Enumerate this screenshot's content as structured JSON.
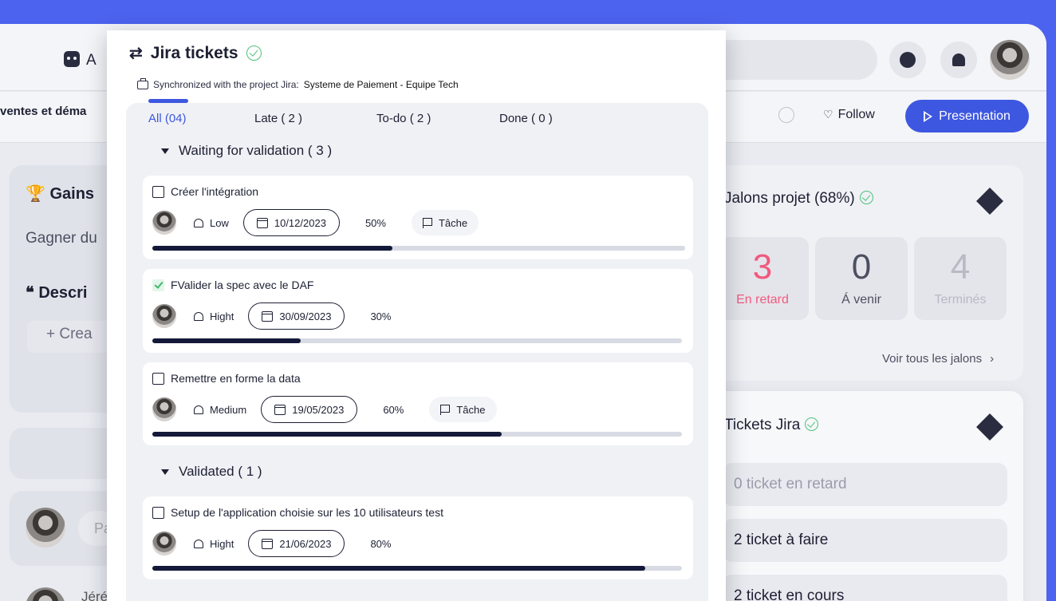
{
  "background": {
    "bot_label": "A",
    "breadcrumb": "ventes et déma",
    "follow_label": "Follow",
    "presentation_label": "Presentation",
    "left": {
      "gains": "Gains",
      "gagner": "Gagner du",
      "description": "Descri",
      "create": "Crea",
      "pill": "Pa",
      "name": "Jéré"
    },
    "jalons": {
      "title": "Jalons projet (68%)",
      "stats": [
        {
          "value": "3",
          "label": "En retard",
          "color": "#f05a7e"
        },
        {
          "value": "0",
          "label": "Á venir",
          "color": "#4c4f60"
        },
        {
          "value": "4",
          "label": "Terminés",
          "color": "#b8bac4"
        }
      ],
      "link": "Voir tous les jalons"
    },
    "tickets_jira": {
      "title": "Tickets Jira",
      "rows": [
        "0 ticket en retard",
        "2 ticket à faire",
        "2 ticket en cours"
      ]
    }
  },
  "modal": {
    "title": "Jira tickets",
    "sync_prefix": "Synchronized with the project Jira:",
    "sync_project": "Systeme de Paiement - Equipe Tech",
    "tabs": [
      "All (04)",
      "Late ( 2 )",
      "To-do ( 2 )",
      "Done ( 0 )"
    ],
    "groups": [
      {
        "label": "Waiting for validation ( 3 )"
      },
      {
        "label": "Validated ( 1 )"
      }
    ],
    "tickets": [
      {
        "title": "Créer l'intégration",
        "priority": "Low",
        "date": "10/12/2023",
        "progress": "50%",
        "progress_value": 0.45,
        "tag": "Tâche",
        "checked": false
      },
      {
        "title": "FValider la spec avec le DAF",
        "priority": "Hight",
        "date": "30/09/2023",
        "progress": "30%",
        "progress_value": 0.28,
        "tag": "",
        "checked": true
      },
      {
        "title": "Remettre en forme la data",
        "priority": "Medium",
        "date": "19/05/2023",
        "progress": "60%",
        "progress_value": 0.66,
        "tag": "Tâche",
        "checked": false
      },
      {
        "title": "Setup de l'application choisie sur les 10 utilisateurs test",
        "priority": "Hight",
        "date": "21/06/2023",
        "progress": "80%",
        "progress_value": 0.93,
        "tag": "",
        "checked": false
      }
    ]
  }
}
